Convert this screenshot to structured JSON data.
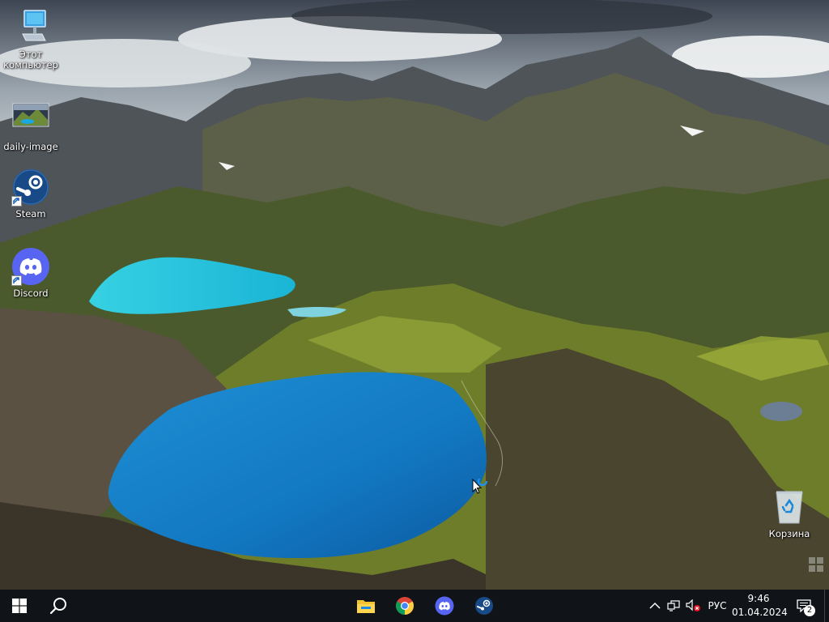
{
  "desktop": {
    "icons": [
      {
        "id": "this-pc",
        "label": "Этот компьютер"
      },
      {
        "id": "daily-image",
        "label": "daily-image"
      },
      {
        "id": "steam",
        "label": "Steam"
      },
      {
        "id": "discord",
        "label": "Discord"
      },
      {
        "id": "recycle-bin",
        "label": "Корзина"
      }
    ]
  },
  "taskbar": {
    "start_icon": "windows-start-icon",
    "search_icon": "search-icon",
    "pinned": [
      {
        "name": "file-explorer",
        "icon": "folder-icon"
      },
      {
        "name": "chrome",
        "icon": "chrome-icon"
      },
      {
        "name": "discord",
        "icon": "discord-icon"
      },
      {
        "name": "steam",
        "icon": "steam-icon"
      }
    ],
    "tray": {
      "chevron_icon": "chevron-up-icon",
      "network_icon": "network-icon",
      "volume_icon": "volume-muted-icon",
      "language": "РУС",
      "time": "9:46",
      "date": "01.04.2024",
      "notifications_count": "2"
    }
  },
  "colors": {
    "taskbar_bg": "#101418",
    "discord_blurple": "#5865f2",
    "steam_blue": "#1b4f8a",
    "accent": "#4cc2ff"
  }
}
